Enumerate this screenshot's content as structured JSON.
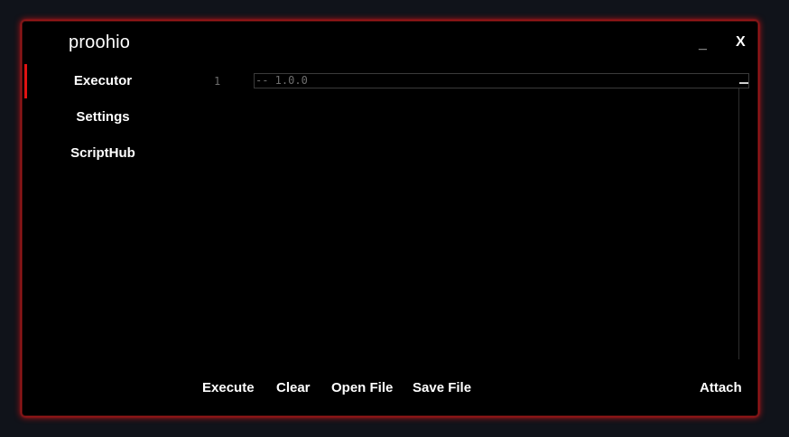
{
  "window": {
    "title": "proohio",
    "minimize_label": "_",
    "close_label": "X"
  },
  "sidebar": {
    "items": [
      {
        "label": "Executor",
        "active": true
      },
      {
        "label": "Settings",
        "active": false
      },
      {
        "label": "ScriptHub",
        "active": false
      }
    ]
  },
  "editor": {
    "line_number": "1",
    "content": "-- 1.0.0"
  },
  "actions": {
    "execute": "Execute",
    "clear": "Clear",
    "open_file": "Open File",
    "save_file": "Save File",
    "attach": "Attach"
  },
  "colors": {
    "accent": "#e01212",
    "window_background": "#000000",
    "page_background": "#10131a",
    "text": "#ffffff",
    "editor_text": "#6e6e6e"
  }
}
